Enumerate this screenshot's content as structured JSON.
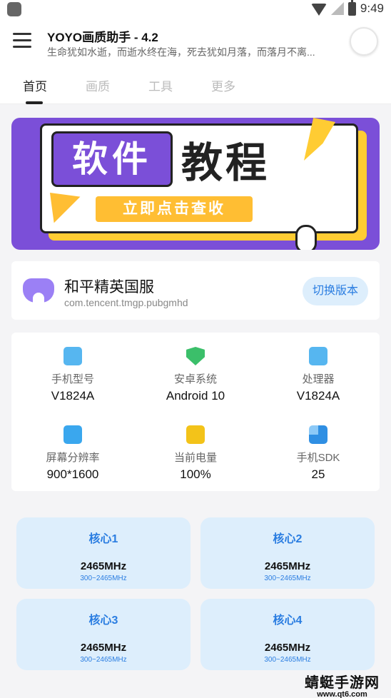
{
  "status_bar": {
    "time": "9:49"
  },
  "header": {
    "title": "YOYO画质助手 - 4.2",
    "subtitle": "生命犹如水逝，而逝水终在海，死去犹如月落，而落月不离..."
  },
  "tabs": [
    {
      "label": "首页",
      "active": true
    },
    {
      "label": "画质",
      "active": false
    },
    {
      "label": "工具",
      "active": false
    },
    {
      "label": "更多",
      "active": false
    }
  ],
  "banner": {
    "word1": "软件",
    "word2": "教程",
    "cta": "立即点击查收"
  },
  "game": {
    "name": "和平精英国服",
    "package": "com.tencent.tmgp.pubgmhd",
    "switch_label": "切换版本"
  },
  "device_info": [
    {
      "label": "手机型号",
      "value": "V1824A",
      "icon": "android-icon"
    },
    {
      "label": "安卓系统",
      "value": "Android 10",
      "icon": "shield-icon"
    },
    {
      "label": "处理器",
      "value": "V1824A",
      "icon": "android-icon"
    },
    {
      "label": "屏幕分辨率",
      "value": "900*1600",
      "icon": "pulse-icon"
    },
    {
      "label": "当前电量",
      "value": "100%",
      "icon": "battery-icon"
    },
    {
      "label": "手机SDK",
      "value": "25",
      "icon": "pie-icon"
    }
  ],
  "cores": [
    {
      "name": "核心1",
      "freq": "2465MHz",
      "range": "300~2465MHz"
    },
    {
      "name": "核心2",
      "freq": "2465MHz",
      "range": "300~2465MHz"
    },
    {
      "name": "核心3",
      "freq": "2465MHz",
      "range": "300~2465MHz"
    },
    {
      "name": "核心4",
      "freq": "2465MHz",
      "range": "300~2465MHz"
    }
  ],
  "watermark": {
    "text": "蜻蜓手游网",
    "url": "www.qt6.com"
  },
  "colors": {
    "accent": "#2a7de1",
    "banner_purple": "#7b4fd8",
    "banner_yellow": "#ffbe33"
  }
}
